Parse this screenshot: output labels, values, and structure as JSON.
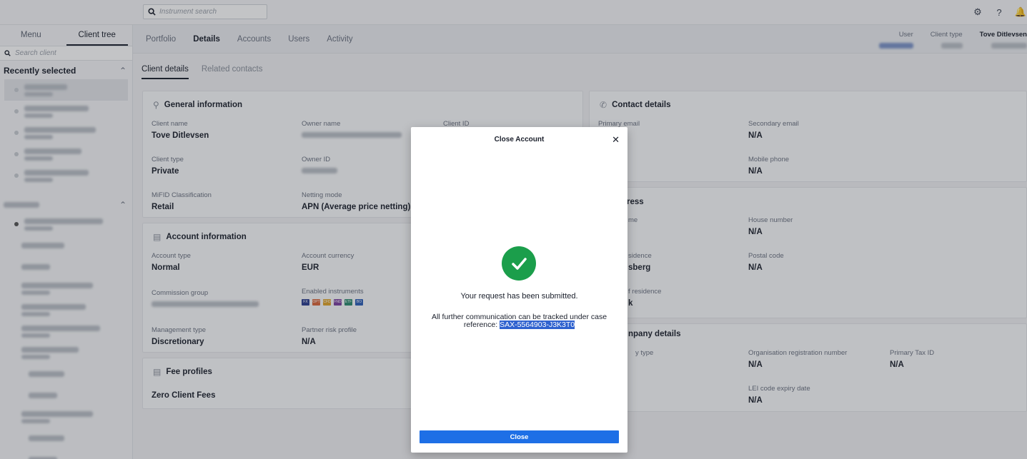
{
  "topbar": {
    "search_placeholder": "Instrument search"
  },
  "left_panel": {
    "tabs": [
      "Menu",
      "Client tree"
    ],
    "search_placeholder": "Search client",
    "recently_selected_label": "Recently selected"
  },
  "main_tabs": [
    "Portfolio",
    "Details",
    "Accounts",
    "Users",
    "Activity"
  ],
  "header_info": {
    "user_label": "User",
    "client_type_label": "Client type",
    "client_name": "Tove Ditlevsen"
  },
  "sub_tabs": [
    "Client details",
    "Related contacts"
  ],
  "general": {
    "title": "General information",
    "client_name_label": "Client name",
    "client_name": "Tove Ditlevsen",
    "owner_name_label": "Owner name",
    "client_id_label": "Client ID",
    "client_type_label": "Client type",
    "client_type": "Private",
    "owner_id_label": "Owner ID",
    "mifid_label": "MiFID Classification",
    "mifid": "Retail",
    "netting_label": "Netting mode",
    "netting": "APN (Average price netting)"
  },
  "account": {
    "title": "Account information",
    "type_label": "Account type",
    "type": "Normal",
    "currency_label": "Account currency",
    "currency": "EUR",
    "commission_label": "Commission group",
    "instruments_label": "Enabled instruments",
    "instrument_badges": [
      "FX",
      "OPT",
      "CFD",
      "FND",
      "ETF",
      "BO"
    ],
    "mgmt_label": "Management type",
    "mgmt": "Discretionary",
    "risk_label": "Partner risk profile",
    "risk": "N/A"
  },
  "fees": {
    "title": "Fee profiles",
    "value": "Zero Client Fees"
  },
  "contact": {
    "title": "Contact details",
    "primary_email_label": "Primary email",
    "secondary_email_label": "Secondary email",
    "secondary_email": "N/A",
    "mobile_label": "Mobile phone",
    "mobile": "N/A"
  },
  "address": {
    "title_fragment": "ress",
    "name_fragment": "me",
    "house_label": "House number",
    "house": "N/A",
    "residence_fragment": "sidence",
    "city_fragment": "sberg",
    "postal_label": "Postal code",
    "postal": "N/A",
    "country_fragment": "f residence",
    "country_value_fragment": "k"
  },
  "company": {
    "title_fragment": "npany details",
    "entity_fragment": "y type",
    "org_label": "Organisation registration number",
    "org": "N/A",
    "tax_label": "Primary Tax ID",
    "tax": "N/A",
    "lei_label": "LEI code expiry date",
    "lei": "N/A"
  },
  "modal": {
    "title": "Close Account",
    "message": "Your request has been submitted.",
    "detail": "All further communication can be tracked under case reference:",
    "reference": "SAX-5564903-J3K3T0",
    "button": "Close"
  },
  "colors": {
    "accent": "#1e6fe6",
    "success": "#1b9e4b"
  }
}
